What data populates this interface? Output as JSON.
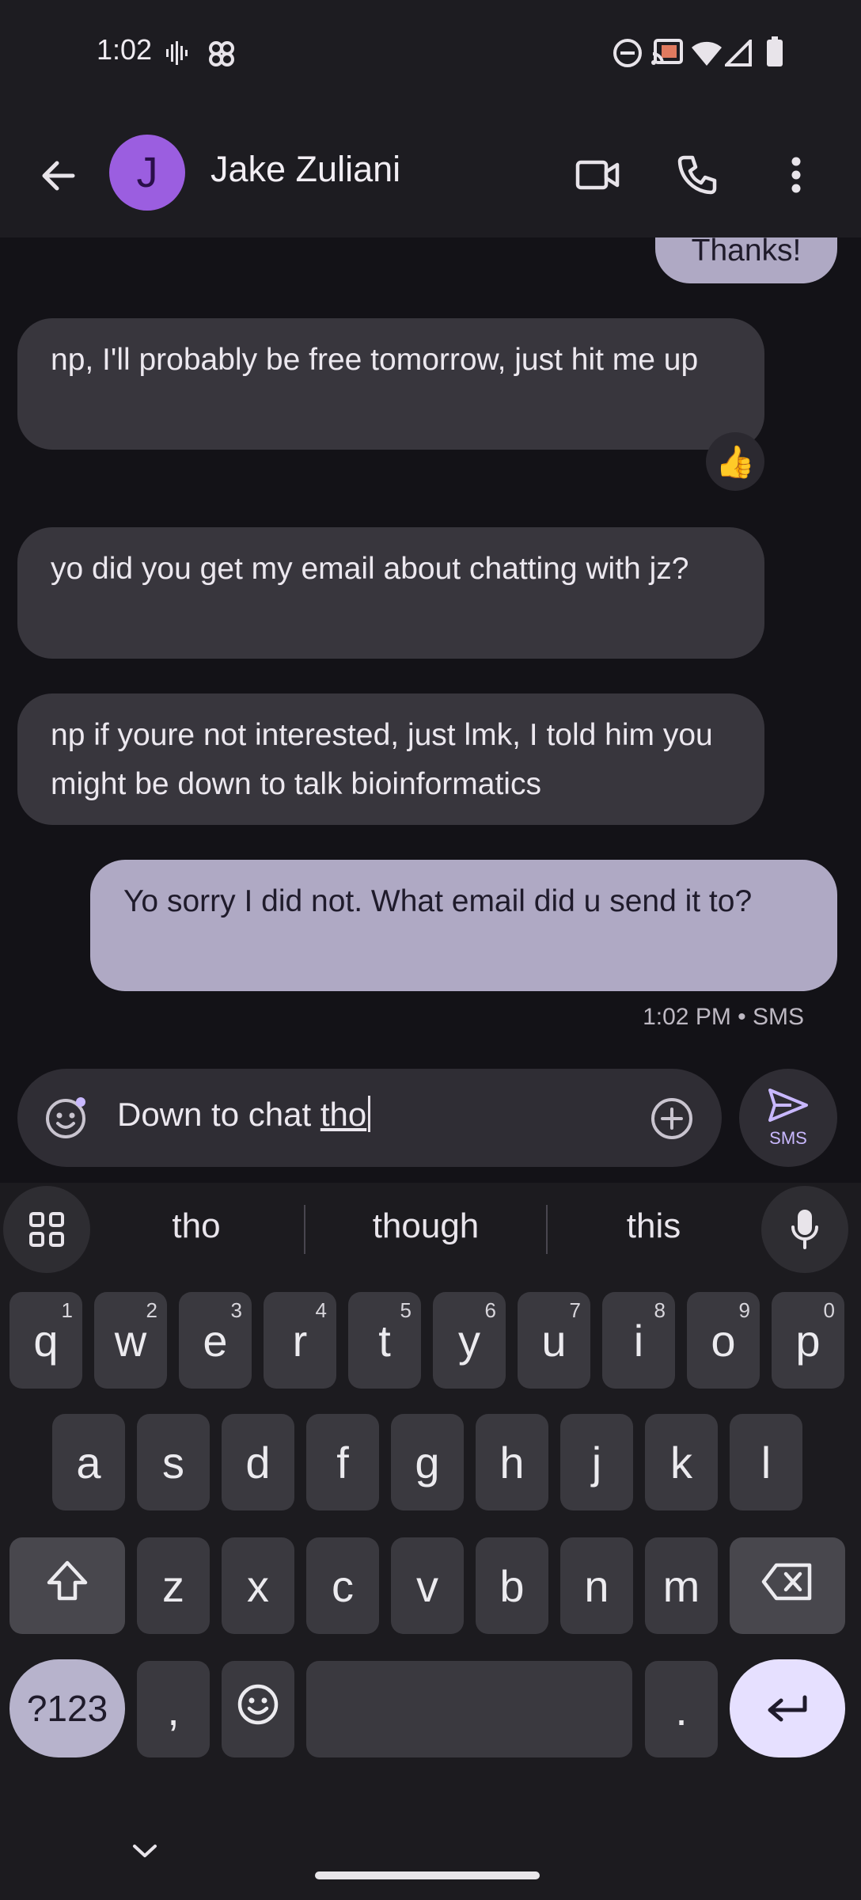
{
  "status_bar": {
    "time": "1:02",
    "icons": [
      "voicemail-icon",
      "pinwheel-icon",
      "do-not-disturb-icon",
      "cast-icon",
      "wifi-icon",
      "cell-signal-icon",
      "battery-icon"
    ]
  },
  "header": {
    "avatar_letter": "J",
    "contact_name": "Jake Zuliani",
    "icons": [
      "back-arrow-icon",
      "video-call-icon",
      "phone-icon",
      "more-vert-icon"
    ]
  },
  "messages": [
    {
      "direction": "outgoing",
      "text": "Thanks!"
    },
    {
      "direction": "incoming",
      "text": "np, I'll probably be free tomorrow, just hit me up",
      "reaction": "👍"
    },
    {
      "direction": "incoming",
      "text": "yo did you get my email about chatting with jz?"
    },
    {
      "direction": "incoming",
      "text": "np if youre not interested, just lmk, I told him you might be down to talk bioinformatics"
    },
    {
      "direction": "outgoing",
      "text": "Yo sorry I did not. What email did u send it to?",
      "meta": "1:02 PM • SMS"
    }
  ],
  "compose": {
    "text_prefix": "Down to chat ",
    "text_current_word": "tho",
    "send_label": "SMS",
    "icons": [
      "emoji-icon",
      "add-circle-icon",
      "send-icon"
    ]
  },
  "keyboard": {
    "suggestions": [
      "tho",
      "though",
      "this"
    ],
    "row1": [
      {
        "key": "q",
        "hint": "1"
      },
      {
        "key": "w",
        "hint": "2"
      },
      {
        "key": "e",
        "hint": "3"
      },
      {
        "key": "r",
        "hint": "4"
      },
      {
        "key": "t",
        "hint": "5"
      },
      {
        "key": "y",
        "hint": "6"
      },
      {
        "key": "u",
        "hint": "7"
      },
      {
        "key": "i",
        "hint": "8"
      },
      {
        "key": "o",
        "hint": "9"
      },
      {
        "key": "p",
        "hint": "0"
      }
    ],
    "row2": [
      "a",
      "s",
      "d",
      "f",
      "g",
      "h",
      "j",
      "k",
      "l"
    ],
    "row3": [
      "z",
      "x",
      "c",
      "v",
      "b",
      "n",
      "m"
    ],
    "symbols_label": "?123",
    "comma_label": ",",
    "period_label": ".",
    "icons": [
      "apps-grid-icon",
      "mic-icon",
      "shift-icon",
      "backspace-icon",
      "emoji-icon",
      "enter-icon",
      "hide-keyboard-icon"
    ]
  }
}
